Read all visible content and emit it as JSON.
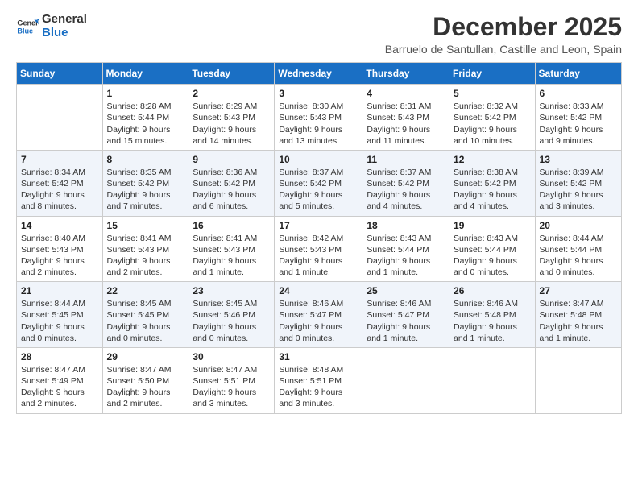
{
  "logo": {
    "text_general": "General",
    "text_blue": "Blue"
  },
  "title": "December 2025",
  "subtitle": "Barruelo de Santullan, Castille and Leon, Spain",
  "headers": [
    "Sunday",
    "Monday",
    "Tuesday",
    "Wednesday",
    "Thursday",
    "Friday",
    "Saturday"
  ],
  "weeks": [
    [
      {
        "day": "",
        "sunrise": "",
        "sunset": "",
        "daylight": ""
      },
      {
        "day": "1",
        "sunrise": "Sunrise: 8:28 AM",
        "sunset": "Sunset: 5:44 PM",
        "daylight": "Daylight: 9 hours and 15 minutes."
      },
      {
        "day": "2",
        "sunrise": "Sunrise: 8:29 AM",
        "sunset": "Sunset: 5:43 PM",
        "daylight": "Daylight: 9 hours and 14 minutes."
      },
      {
        "day": "3",
        "sunrise": "Sunrise: 8:30 AM",
        "sunset": "Sunset: 5:43 PM",
        "daylight": "Daylight: 9 hours and 13 minutes."
      },
      {
        "day": "4",
        "sunrise": "Sunrise: 8:31 AM",
        "sunset": "Sunset: 5:43 PM",
        "daylight": "Daylight: 9 hours and 11 minutes."
      },
      {
        "day": "5",
        "sunrise": "Sunrise: 8:32 AM",
        "sunset": "Sunset: 5:42 PM",
        "daylight": "Daylight: 9 hours and 10 minutes."
      },
      {
        "day": "6",
        "sunrise": "Sunrise: 8:33 AM",
        "sunset": "Sunset: 5:42 PM",
        "daylight": "Daylight: 9 hours and 9 minutes."
      }
    ],
    [
      {
        "day": "7",
        "sunrise": "Sunrise: 8:34 AM",
        "sunset": "Sunset: 5:42 PM",
        "daylight": "Daylight: 9 hours and 8 minutes."
      },
      {
        "day": "8",
        "sunrise": "Sunrise: 8:35 AM",
        "sunset": "Sunset: 5:42 PM",
        "daylight": "Daylight: 9 hours and 7 minutes."
      },
      {
        "day": "9",
        "sunrise": "Sunrise: 8:36 AM",
        "sunset": "Sunset: 5:42 PM",
        "daylight": "Daylight: 9 hours and 6 minutes."
      },
      {
        "day": "10",
        "sunrise": "Sunrise: 8:37 AM",
        "sunset": "Sunset: 5:42 PM",
        "daylight": "Daylight: 9 hours and 5 minutes."
      },
      {
        "day": "11",
        "sunrise": "Sunrise: 8:37 AM",
        "sunset": "Sunset: 5:42 PM",
        "daylight": "Daylight: 9 hours and 4 minutes."
      },
      {
        "day": "12",
        "sunrise": "Sunrise: 8:38 AM",
        "sunset": "Sunset: 5:42 PM",
        "daylight": "Daylight: 9 hours and 4 minutes."
      },
      {
        "day": "13",
        "sunrise": "Sunrise: 8:39 AM",
        "sunset": "Sunset: 5:42 PM",
        "daylight": "Daylight: 9 hours and 3 minutes."
      }
    ],
    [
      {
        "day": "14",
        "sunrise": "Sunrise: 8:40 AM",
        "sunset": "Sunset: 5:43 PM",
        "daylight": "Daylight: 9 hours and 2 minutes."
      },
      {
        "day": "15",
        "sunrise": "Sunrise: 8:41 AM",
        "sunset": "Sunset: 5:43 PM",
        "daylight": "Daylight: 9 hours and 2 minutes."
      },
      {
        "day": "16",
        "sunrise": "Sunrise: 8:41 AM",
        "sunset": "Sunset: 5:43 PM",
        "daylight": "Daylight: 9 hours and 1 minute."
      },
      {
        "day": "17",
        "sunrise": "Sunrise: 8:42 AM",
        "sunset": "Sunset: 5:43 PM",
        "daylight": "Daylight: 9 hours and 1 minute."
      },
      {
        "day": "18",
        "sunrise": "Sunrise: 8:43 AM",
        "sunset": "Sunset: 5:44 PM",
        "daylight": "Daylight: 9 hours and 1 minute."
      },
      {
        "day": "19",
        "sunrise": "Sunrise: 8:43 AM",
        "sunset": "Sunset: 5:44 PM",
        "daylight": "Daylight: 9 hours and 0 minutes."
      },
      {
        "day": "20",
        "sunrise": "Sunrise: 8:44 AM",
        "sunset": "Sunset: 5:44 PM",
        "daylight": "Daylight: 9 hours and 0 minutes."
      }
    ],
    [
      {
        "day": "21",
        "sunrise": "Sunrise: 8:44 AM",
        "sunset": "Sunset: 5:45 PM",
        "daylight": "Daylight: 9 hours and 0 minutes."
      },
      {
        "day": "22",
        "sunrise": "Sunrise: 8:45 AM",
        "sunset": "Sunset: 5:45 PM",
        "daylight": "Daylight: 9 hours and 0 minutes."
      },
      {
        "day": "23",
        "sunrise": "Sunrise: 8:45 AM",
        "sunset": "Sunset: 5:46 PM",
        "daylight": "Daylight: 9 hours and 0 minutes."
      },
      {
        "day": "24",
        "sunrise": "Sunrise: 8:46 AM",
        "sunset": "Sunset: 5:47 PM",
        "daylight": "Daylight: 9 hours and 0 minutes."
      },
      {
        "day": "25",
        "sunrise": "Sunrise: 8:46 AM",
        "sunset": "Sunset: 5:47 PM",
        "daylight": "Daylight: 9 hours and 1 minute."
      },
      {
        "day": "26",
        "sunrise": "Sunrise: 8:46 AM",
        "sunset": "Sunset: 5:48 PM",
        "daylight": "Daylight: 9 hours and 1 minute."
      },
      {
        "day": "27",
        "sunrise": "Sunrise: 8:47 AM",
        "sunset": "Sunset: 5:48 PM",
        "daylight": "Daylight: 9 hours and 1 minute."
      }
    ],
    [
      {
        "day": "28",
        "sunrise": "Sunrise: 8:47 AM",
        "sunset": "Sunset: 5:49 PM",
        "daylight": "Daylight: 9 hours and 2 minutes."
      },
      {
        "day": "29",
        "sunrise": "Sunrise: 8:47 AM",
        "sunset": "Sunset: 5:50 PM",
        "daylight": "Daylight: 9 hours and 2 minutes."
      },
      {
        "day": "30",
        "sunrise": "Sunrise: 8:47 AM",
        "sunset": "Sunset: 5:51 PM",
        "daylight": "Daylight: 9 hours and 3 minutes."
      },
      {
        "day": "31",
        "sunrise": "Sunrise: 8:48 AM",
        "sunset": "Sunset: 5:51 PM",
        "daylight": "Daylight: 9 hours and 3 minutes."
      },
      {
        "day": "",
        "sunrise": "",
        "sunset": "",
        "daylight": ""
      },
      {
        "day": "",
        "sunrise": "",
        "sunset": "",
        "daylight": ""
      },
      {
        "day": "",
        "sunrise": "",
        "sunset": "",
        "daylight": ""
      }
    ]
  ]
}
